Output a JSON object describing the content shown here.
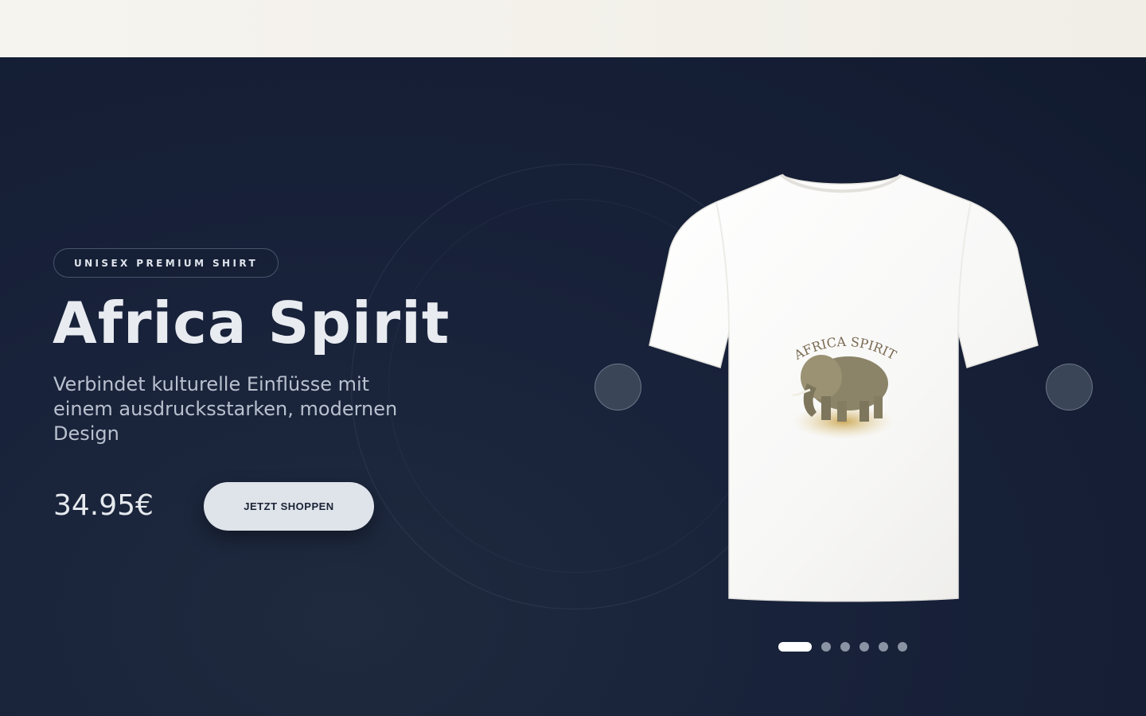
{
  "hero": {
    "badge": "UNISEX PREMIUM SHIRT",
    "title": "Africa Spirit",
    "description": "Verbindet kulturelle Einflüsse mit einem ausdrucksstarken, modernen Design",
    "price": "34.95€",
    "cta_label": "JETZT SHOPPEN"
  },
  "carousel": {
    "prev_icon": "chevron-left-icon",
    "next_icon": "chevron-right-icon",
    "prev_glyph": "",
    "next_glyph": "",
    "slide_count": 6,
    "active_index": 0
  },
  "product_print": {
    "text": "AFRICA SPIRIT",
    "image": "elephant-illustration"
  },
  "colors": {
    "hero_bg": "#16203a",
    "accent_button": "#dfe3ea",
    "dot_active": "#ffffff",
    "dot_inactive": "#8a93a3"
  }
}
